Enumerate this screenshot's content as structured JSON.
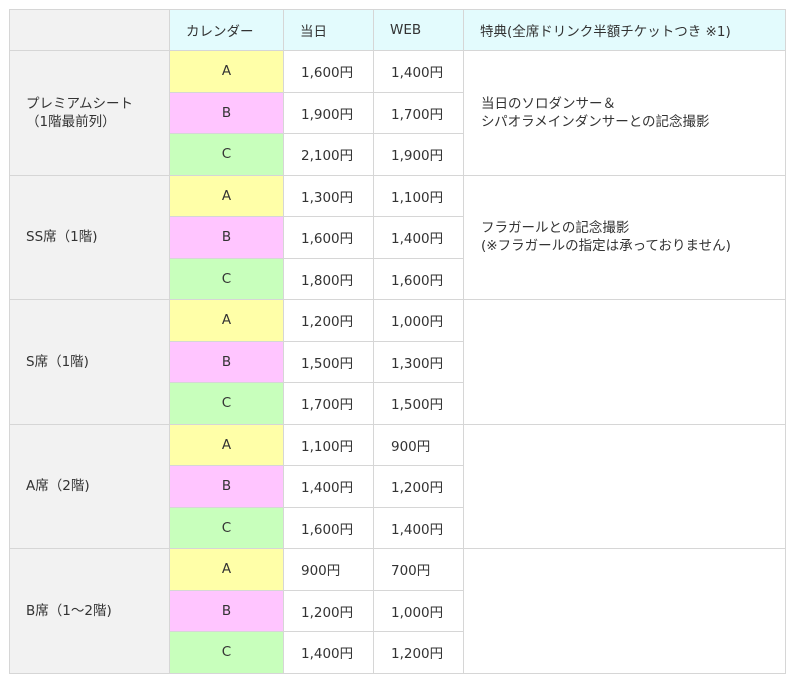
{
  "header": {
    "calendar": "カレンダー",
    "day": "当日",
    "web": "WEB",
    "benefit": "特典(全席ドリンク半額チケットつき ※1)"
  },
  "groups": [
    {
      "name": "プレミアムシート",
      "sub": "（1階最前列）",
      "benefit_lines": [
        "当日のソロダンサー＆",
        "シパオラメインダンサーとの記念撮影"
      ],
      "rows": [
        {
          "cal": "A",
          "day": "1,600円",
          "web": "1,400円"
        },
        {
          "cal": "B",
          "day": "1,900円",
          "web": "1,700円"
        },
        {
          "cal": "C",
          "day": "2,100円",
          "web": "1,900円"
        }
      ]
    },
    {
      "name": "SS席（1階)",
      "sub": "",
      "benefit_lines": [
        "フラガールとの記念撮影",
        "(※フラガールの指定は承っておりません)"
      ],
      "rows": [
        {
          "cal": "A",
          "day": "1,300円",
          "web": "1,100円"
        },
        {
          "cal": "B",
          "day": "1,600円",
          "web": "1,400円"
        },
        {
          "cal": "C",
          "day": "1,800円",
          "web": "1,600円"
        }
      ]
    },
    {
      "name": "S席（1階)",
      "sub": "",
      "benefit_lines": [
        "",
        ""
      ],
      "rows": [
        {
          "cal": "A",
          "day": "1,200円",
          "web": "1,000円"
        },
        {
          "cal": "B",
          "day": "1,500円",
          "web": "1,300円"
        },
        {
          "cal": "C",
          "day": "1,700円",
          "web": "1,500円"
        }
      ]
    },
    {
      "name": "A席（2階)",
      "sub": "",
      "benefit_lines": [
        "",
        ""
      ],
      "rows": [
        {
          "cal": "A",
          "day": "1,100円",
          "web": "900円"
        },
        {
          "cal": "B",
          "day": "1,400円",
          "web": "1,200円"
        },
        {
          "cal": "C",
          "day": "1,600円",
          "web": "1,400円"
        }
      ]
    },
    {
      "name": "B席（1〜2階)",
      "sub": "",
      "benefit_lines": [
        "",
        ""
      ],
      "rows": [
        {
          "cal": "A",
          "day": "900円",
          "web": "700円"
        },
        {
          "cal": "B",
          "day": "1,200円",
          "web": "1,000円"
        },
        {
          "cal": "C",
          "day": "1,400円",
          "web": "1,200円"
        }
      ]
    }
  ],
  "colors": {
    "header_bg": "#e3fbfd",
    "group_bg": "#f2f2f2",
    "cal_a": "#ffffa8",
    "cal_b": "#ffc5ff",
    "cal_c": "#c8ffbc"
  }
}
